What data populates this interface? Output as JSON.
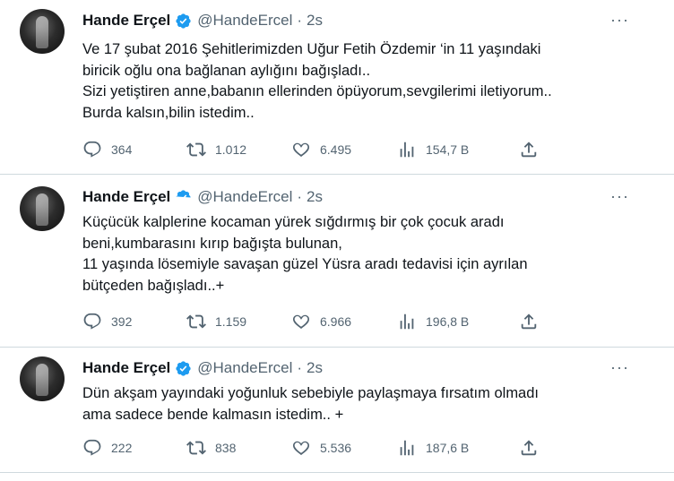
{
  "tweets": [
    {
      "name": "Hande Erçel",
      "handle": "@HandeErcel",
      "separator": "·",
      "time": "2s",
      "more": "···",
      "lines": [
        "Ve 17 şubat 2016 Şehitlerimizden Uğur Fetih Özdemir ‘in 11 yaşındaki",
        "biricik oğlu ona bağlanan aylığını bağışladı..",
        "Sizi yetiştiren anne,babanın ellerinden öpüyorum,sevgilerimi iletiyorum..",
        "Burda kalsın,bilin istedim.."
      ],
      "stats": {
        "replies": "364",
        "retweets": "1.012",
        "likes": "6.495",
        "views": "154,7 B"
      }
    },
    {
      "name": "Hande Erçel",
      "handle": "@HandeErcel",
      "separator": "·",
      "time": "2s",
      "more": "···",
      "lines": [
        "Küçücük kalplerine kocaman yürek sığdırmış bir çok çocuk aradı",
        "beni,kumbarasını kırıp bağışta bulunan,",
        "11 yaşında lösemiyle savaşan güzel Yüsra aradı tedavisi için ayrılan",
        "bütçeden bağışladı..+"
      ],
      "stats": {
        "replies": "392",
        "retweets": "1.159",
        "likes": "6.966",
        "views": "196,8 B"
      }
    },
    {
      "name": "Hande Erçel",
      "handle": "@HandeErcel",
      "separator": "·",
      "time": "2s",
      "more": "···",
      "lines": [
        "Dün akşam yayındaki yoğunluk sebebiyle paylaşmaya fırsatım olmadı",
        "ama sadece bende kalmasın istedim.. +"
      ],
      "stats": {
        "replies": "222",
        "retweets": "838",
        "likes": "5.536",
        "views": "187,6 B"
      }
    }
  ],
  "icons": {
    "verified": "verified-badge-icon",
    "reply": "reply-icon",
    "retweet": "retweet-icon",
    "like": "heart-icon",
    "views": "views-bar-chart-icon",
    "share": "share-icon"
  },
  "colors": {
    "verified": "#1d9bf0",
    "text": "#0f1419",
    "secondary": "#536471",
    "border": "#cfd9de"
  }
}
